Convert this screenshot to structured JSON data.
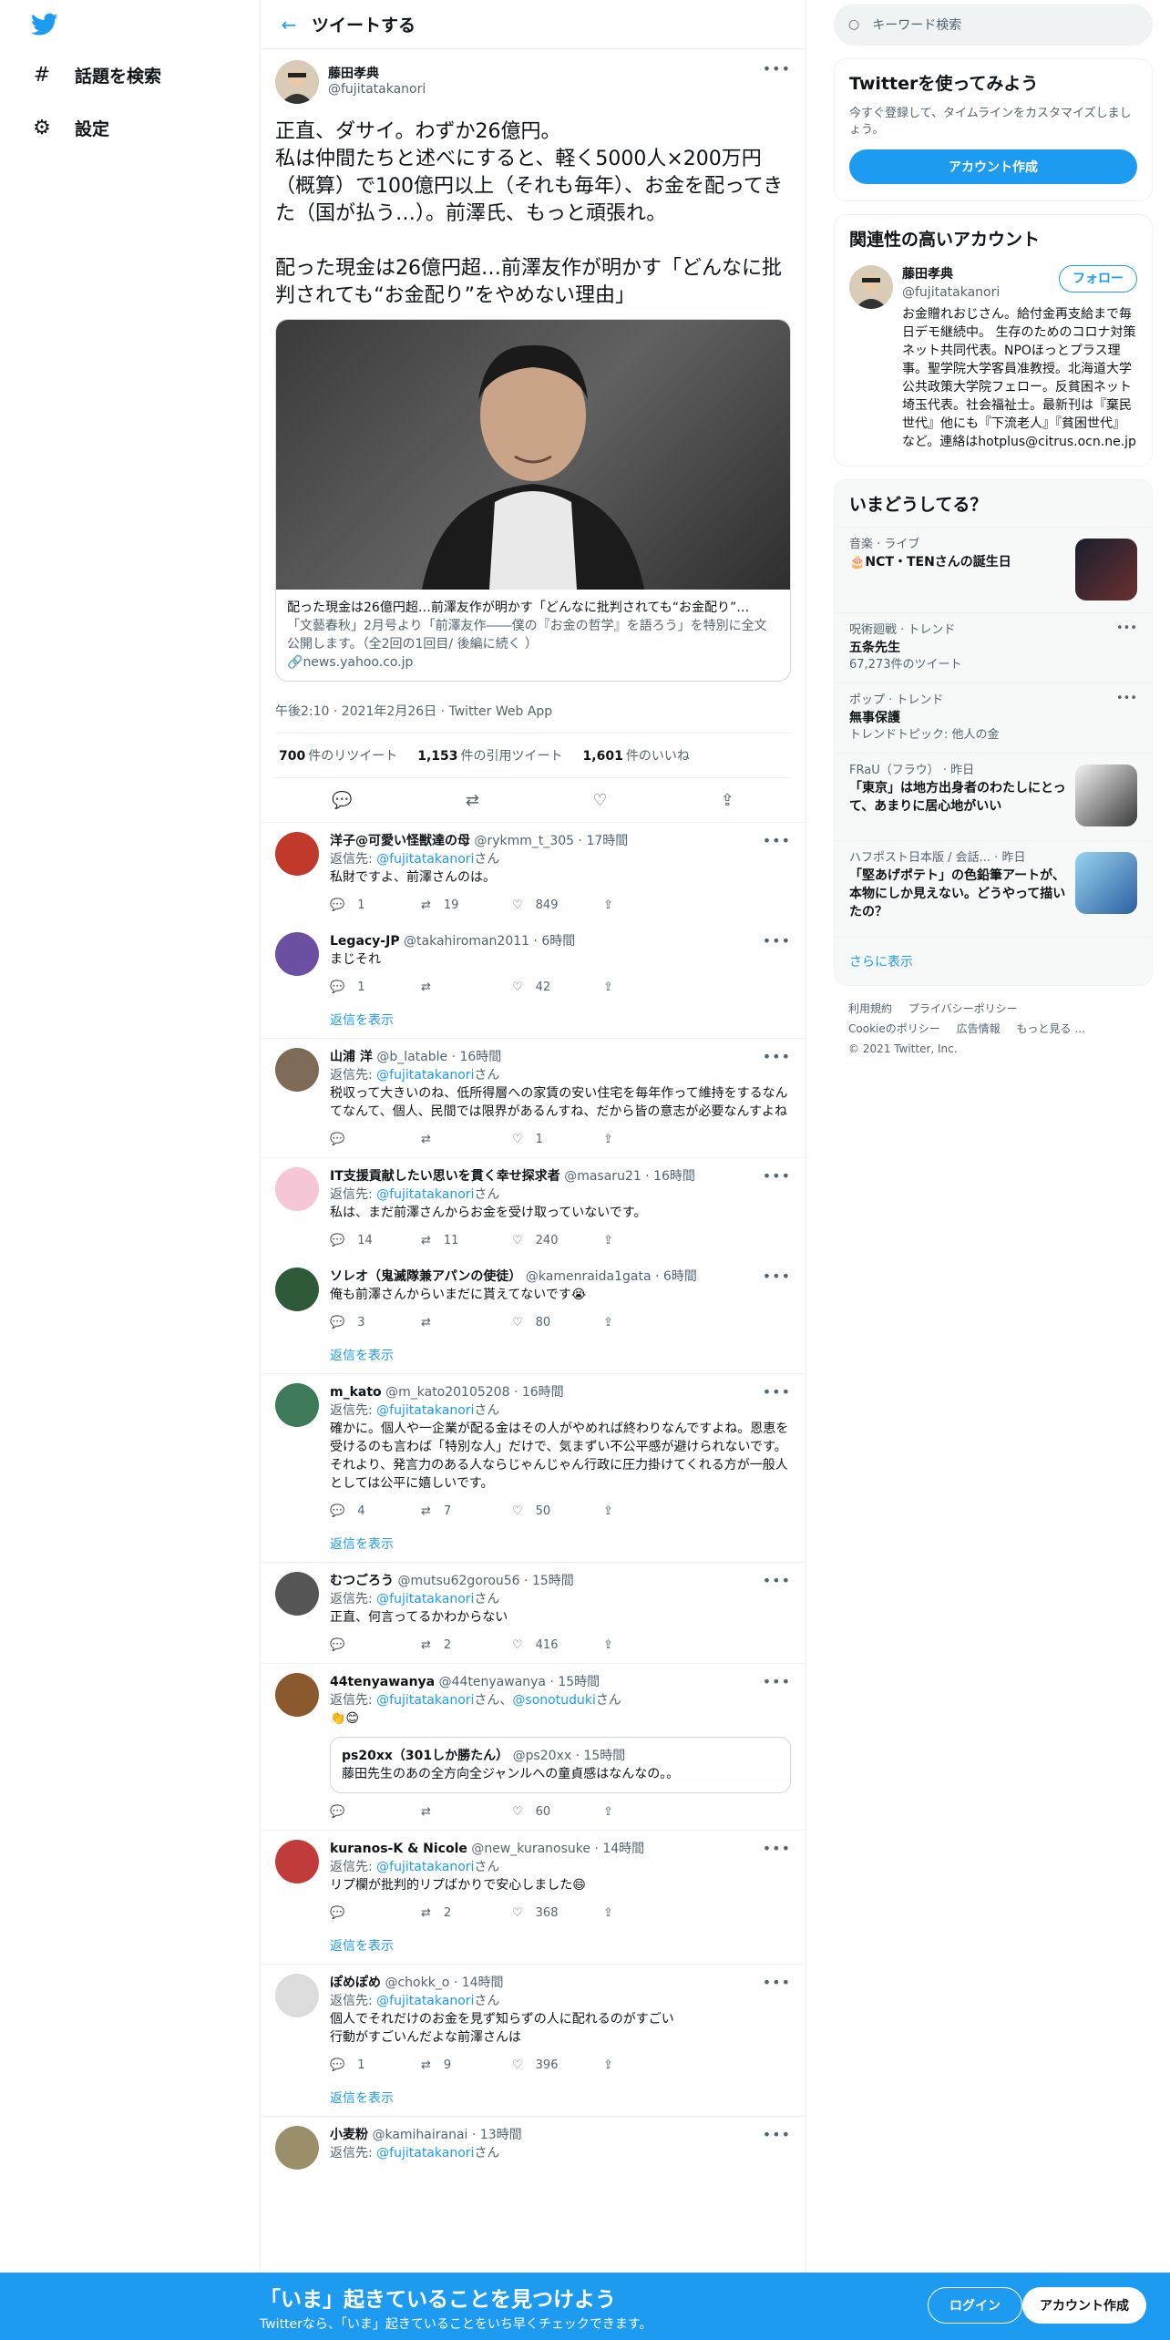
{
  "nav": {
    "explore": "話題を検索",
    "settings": "設定"
  },
  "header": {
    "title": "ツイートする"
  },
  "main": {
    "name": "藤田孝典",
    "handle": "@fujitatakanori",
    "text": "正直、ダサイ。わずか26億円。\n私は仲間たちと述べにすると、軽く5000人×200万円（概算）で100億円以上（それも毎年）、お金を配ってきた（国が払う…）。前澤氏、もっと頑張れ。\n\n配った現金は26億円超…前澤友作が明かす「どんなに批判されても“お金配り”をやめない理由」",
    "card_title": "配った現金は26億円超…前澤友作が明かす「どんなに批判されても“お金配り”…",
    "card_desc": "「文藝春秋」2月号より「前澤友作――僕の『お金の哲学』を語ろう」を特別に全文公開します。（全2回の1回目/ 後編に続く ）",
    "card_link": "news.yahoo.co.jp",
    "timestamp": "午後2:10 · 2021年2月26日 · Twitter Web App",
    "retweets": "700",
    "retweets_label": "件のリツイート",
    "quotes": "1,153",
    "quotes_label": "件の引用ツイート",
    "likes": "1,601",
    "likes_label": "件のいいね"
  },
  "replying_label": "返信先:",
  "san": "さん",
  "show_replies": "返信を表示",
  "replies": [
    {
      "name": "洋子@可愛い怪獣達の母",
      "meta": "@rykmm_t_305 · 17時間",
      "to": "@fujitatakanori",
      "text": "私財ですよ、前澤さんのは。",
      "reply": "1",
      "rt": "19",
      "like": "849",
      "avc": "#c0392b"
    },
    {
      "name": "Legacy-JP",
      "meta": "@takahiroman2011 · 6時間",
      "to": "",
      "text": "まじそれ",
      "reply": "1",
      "rt": "",
      "like": "42",
      "avc": "#6b4fa0"
    },
    {
      "name": "山浦 洋",
      "meta": "@b_latable · 16時間",
      "to": "@fujitatakanori",
      "text": "税収って大きいのね、低所得層への家賃の安い住宅を毎年作って維持をするなんてなんて、個人、民間では限界があるんすね、だから皆の意志が必要なんすよね",
      "reply": "",
      "rt": "",
      "like": "1",
      "avc": "#7d6b57"
    },
    {
      "name": "IT支援貢献したい思いを貫く幸せ探求者",
      "meta": "@masaru21 · 16時間",
      "to": "@fujitatakanori",
      "text": "私は、まだ前澤さんからお金を受け取っていないです。",
      "reply": "14",
      "rt": "11",
      "like": "240",
      "avc": "#f5c6d6"
    },
    {
      "name": "ソレオ（鬼滅隊兼アパンの使徒）",
      "meta": "@kamenraida1gata · 6時間",
      "to": "",
      "text": "俺も前澤さんからいまだに貰えてないです😭",
      "reply": "3",
      "rt": "",
      "like": "80",
      "avc": "#2f5a3a"
    },
    {
      "name": "m_kato",
      "meta": "@m_kato20105208 · 16時間",
      "to": "@fujitatakanori",
      "text": "確かに。個人や一企業が配る金はその人がやめれば終わりなんですよね。恩恵を受けるのも言わば「特別な人」だけで、気まずい不公平感が避けられないです。\nそれより、発言力のある人ならじゃんじゃん行政に圧力掛けてくれる方が一般人としては公平に嬉しいです。",
      "reply": "4",
      "rt": "7",
      "like": "50",
      "avc": "#3c7a5a"
    },
    {
      "name": "むつごろう",
      "meta": "@mutsu62gorou56 · 15時間",
      "to": "@fujitatakanori",
      "text": "正直、何言ってるかわからない",
      "reply": "",
      "rt": "2",
      "like": "416",
      "avc": "#555"
    },
    {
      "name": "44tenyawanya",
      "meta": "@44tenyawanya · 15時間",
      "to": "@fujitatakanori",
      "to2": "@sonotuduki",
      "text": "👏😊",
      "reply": "",
      "rt": "",
      "like": "60",
      "avc": "#8a5a2e"
    },
    {
      "name": "kuranos-K & Nicole",
      "meta": "@new_kuranosuke · 14時間",
      "to": "@fujitatakanori",
      "text": "リプ欄が批判的リプばかりで安心しました😄",
      "reply": "",
      "rt": "2",
      "like": "368",
      "avc": "#c23b3b"
    },
    {
      "name": "ぽめぽめ",
      "meta": "@chokk_o · 14時間",
      "to": "@fujitatakanori",
      "text": "個人でそれだけのお金を見ず知らずの人に配れるのがすごい\n行動がすごいんだよな前澤さんは",
      "reply": "1",
      "rt": "9",
      "like": "396",
      "avc": "#dcdcdc"
    },
    {
      "name": "小麦粉",
      "meta": "@kamihairanai · 13時間",
      "to": "@fujitatakanori",
      "text": "",
      "reply": "",
      "rt": "",
      "like": "",
      "avc": "#9a8f6a"
    }
  ],
  "quote": {
    "name": "ps20xx（301しか勝たん）",
    "meta": "@ps20xx · 15時間",
    "text": "藤田先生のあの全方向全ジャンルへの童貞感はなんなの。。"
  },
  "sidebar": {
    "search_placeholder": "キーワード検索",
    "signup_title": "Twitterを使ってみよう",
    "signup_text": "今すぐ登録して、タイムラインをカスタマイズしましょう。",
    "signup_button": "アカウント作成",
    "related_title": "関連性の高いアカウント",
    "rel_name": "藤田孝典",
    "rel_handle": "@fujitatakanori",
    "follow": "フォロー",
    "rel_bio": "お金贈れおじさん。給付金再支給まで毎日デモ継続中。 生存のためのコロナ対策ネット共同代表。NPOほっとプラス理事。聖学院大学客員准教授。北海道大学公共政策大学院フェロー。反貧困ネット埼玉代表。社会福祉士。最新刊は『棄民世代』他にも『下流老人』『貧困世代』など。連絡はhotplus@citrus.ocn.ne.jp",
    "trends_title": "いまどうしてる？",
    "trends": [
      {
        "cat": "音楽 · ライブ",
        "title": "🎂NCT・TENさんの誕生日",
        "sub": ""
      },
      {
        "cat": "呪術廻戦 · トレンド",
        "title": "五条先生",
        "sub": "67,273件のツイート"
      },
      {
        "cat": "ポップ · トレンド",
        "title": "無事保護",
        "sub": "トレンドトピック: 他人の金"
      },
      {
        "cat": "FRaU（フラウ） · 昨日",
        "title": "「東京」は地方出身者のわたしにとって、あまりに居心地がいい",
        "sub": ""
      },
      {
        "cat": "ハフポスト日本版 / 会話... · 昨日",
        "title": "「堅あげポテト」の色鉛筆アートが、本物にしか見えない。どうやって描いたの？",
        "sub": ""
      }
    ],
    "show_more": "さらに表示",
    "footer1": "利用規約",
    "footer2": "プライバシーポリシー",
    "footer3": "Cookieのポリシー",
    "footer4": "広告情報",
    "footer5": "もっと見る …",
    "copyright": "© 2021 Twitter, Inc."
  },
  "bottom": {
    "headline": "「いま」起きていることを見つけよう",
    "sub": "Twitterなら、「いま」起きていることをいち早くチェックできます。",
    "login": "ログイン",
    "signup": "アカウント作成"
  },
  "colors": {
    "accent": "#1d9bf0"
  }
}
